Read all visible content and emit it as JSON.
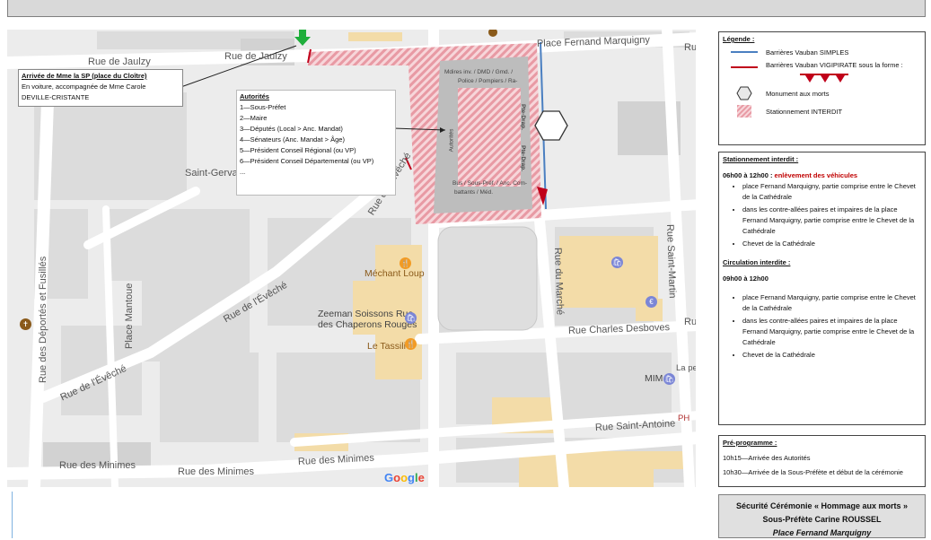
{
  "map": {
    "streets": {
      "rue_de_jaulzy_1": "Rue de Jaulzy",
      "rue_de_jaulzy_2": "Rue de Jaulzy",
      "place_fernand_marquigny": "Place Fernand Marquigny",
      "saint_gervais": "Saint-Gervais-",
      "rue_de_l_eveche_1": "Rue de l'Évêché",
      "rue_de_l_eveche_2": "Rue de l'Évêché",
      "rue_de_l_eveche_3": "Rue de l'Évêché",
      "rue_des_deportes": "Rue des Déportés et Fusillés",
      "place_mantoue": "Place Mantoue",
      "rue_du_marche": "Rue du Marché",
      "rue_saint_martin": "Rue Saint-Martin",
      "rue_charles_desboves": "Rue Charles Desboves",
      "rue_saint_antoine": "Rue Saint-Antoine",
      "rue_des_minimes_1": "Rue des Minimes",
      "rue_des_minimes_2": "Rue des Minimes",
      "rue_des_minimes_3": "Rue des Minimes",
      "edge_ru": "Ru",
      "edge_ru2": "Ru",
      "edge_lape": "La pe",
      "edge_ph": "PH"
    },
    "pois": {
      "mechant_loup": "Méchant Loup",
      "zeeman_1": "Zeeman Soissons Rue",
      "zeeman_2": "des Chaperons Rouges",
      "le_tassili": "Le Tassili",
      "mim": "MIM"
    },
    "zone_labels": {
      "top_1": "Mdires inv. / DMD / Gmd. /",
      "top_2": "Police / Pompiers / Ra-",
      "autorites": "Autorités",
      "porte_drap_1": "Pte-Drap.",
      "porte_drap_2": "Pte-Drap.",
      "bottom_1": "Bus / Sous-Préf. / Anc. Com-",
      "bottom_2": "battants / Méd."
    },
    "arrival_callout": {
      "title": "Arrivée de Mme la SP (place du Cloître)",
      "line1": "En voiture, accompagnée de Mme Carole",
      "line2": "DEVILLE-CRISTANTE"
    },
    "authorities_callout": {
      "title": "Autorités",
      "items": [
        "1—Sous-Préfet",
        "2—Maire",
        "3—Députés (Local > Anc. Mandat)",
        "4—Sénateurs (Anc. Mandat > Âge)",
        "5—Président Conseil Régional (ou VP)",
        "6—Président Conseil Départemental (ou VP)",
        "..."
      ]
    },
    "google_logo": [
      "G",
      "o",
      "o",
      "g",
      "l",
      "e"
    ]
  },
  "legend": {
    "title": "Légende :",
    "items": [
      {
        "label": "Barrières Vauban SIMPLES",
        "color": "#4a7fc1"
      },
      {
        "label": "Barrières Vauban VIGIPIRATE sous la forme :",
        "color": "#c0001a"
      },
      {
        "label": "Monument aux morts"
      },
      {
        "label": "Stationnement INTERDIT",
        "color": "#e8a0a8"
      }
    ]
  },
  "rules": {
    "parking_title": "Stationnement interdit :",
    "parking_time": "06h00 à 12h00 :",
    "parking_note": "enlèvement des véhicules",
    "parking_items": [
      "place Fernand Marquigny, partie comprise entre le Chevet de la Cathédrale",
      "dans les contre-allées paires et impaires de la place Fernand Marquigny, partie comprise entre le Chevet de la Cathédrale",
      "Chevet de la Cathédrale"
    ],
    "traffic_title": "Circulation interdite :",
    "traffic_time": "09h00 à 12h00",
    "traffic_items": [
      "place Fernand Marquigny, partie comprise entre le Chevet de la Cathédrale",
      "dans les contre-allées paires et impaires de la place Fernand Marquigny, partie comprise entre le Chevet de la Cathédrale",
      "Chevet de la Cathédrale"
    ]
  },
  "program": {
    "title": "Pré-programme :",
    "items": [
      "10h15—Arrivée des Autorités",
      "10h30—Arrivée de la Sous-Préfète et début de la cérémonie"
    ]
  },
  "ceremony": {
    "line1": "Sécurité Cérémonie « Hommage aux morts »",
    "line2": "Sous-Préfète Carine ROUSSEL",
    "line3": "Place Fernand Marquigny"
  }
}
